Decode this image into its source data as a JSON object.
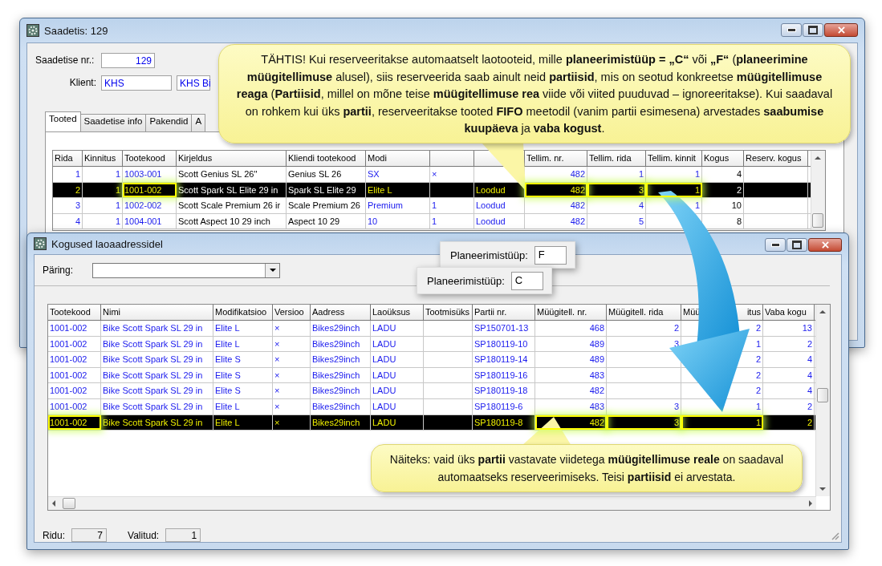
{
  "top_window": {
    "title": "Saadetis: 129",
    "shipment_number": {
      "label": "Saadetise nr.:",
      "value": "129"
    },
    "client": {
      "label": "Klient:",
      "code": "KHS",
      "name": "KHS Bi"
    },
    "tabs": [
      {
        "label": "Tooted",
        "selected": true
      },
      {
        "label": "Saadetise info",
        "selected": false
      },
      {
        "label": "Pakendid",
        "selected": false
      },
      {
        "label": "A",
        "selected": false
      }
    ],
    "table": {
      "columns": [
        {
          "label": "Rida",
          "highlight": false
        },
        {
          "label": "Kinnitus",
          "highlight": false
        },
        {
          "label": "Tootekood",
          "highlight": true
        },
        {
          "label": "Kirjeldus",
          "highlight": false
        },
        {
          "label": "Kliendi tootekood",
          "highlight": false
        },
        {
          "label": "Modi",
          "highlight": false
        },
        {
          "highlight": false
        },
        {
          "highlight": false
        },
        {
          "label": "Tellim. nr.",
          "highlight": true
        },
        {
          "label": "Tellim. rida",
          "highlight": true
        },
        {
          "label": "Tellim. kinnit",
          "highlight": true
        },
        {
          "label": "Kogus",
          "highlight": false
        },
        {
          "label": "Reserv. kogus",
          "highlight": false
        }
      ],
      "rows": [
        {
          "selected": false,
          "cells": [
            "1",
            "1",
            "1003-001",
            "Scott Genius SL 26''",
            "Genius SL 26",
            "SX",
            "×",
            null,
            "482",
            "1",
            "1",
            "4",
            null
          ]
        },
        {
          "selected": true,
          "cells": [
            "2",
            "1",
            "1001-002",
            "Scott Spark SL Elite 29 in",
            "Spark SL Elite 29",
            "Elite L",
            null,
            "Loodud",
            "482",
            "3",
            "1",
            "2",
            null
          ]
        },
        {
          "selected": false,
          "cells": [
            "3",
            "1",
            "1002-002",
            "Scott Scale Premium 26 ir",
            "Scale Premium 26",
            "Premium",
            "1",
            "Loodud",
            "482",
            "4",
            "1",
            "10",
            null
          ]
        },
        {
          "selected": false,
          "cells": [
            "4",
            "1",
            "1004-001",
            "Scott Aspect 10 29 inch",
            "Aspect 10 29",
            "10",
            "1",
            "Loodud",
            "482",
            "5",
            null,
            "8",
            null
          ]
        }
      ]
    }
  },
  "bottom_window": {
    "title": "Kogused laoaadressidel",
    "query": {
      "label": "Päring:"
    },
    "planning_popups": [
      {
        "label": "Planeerimistüüp:",
        "value": "F"
      },
      {
        "label": "Planeerimistüüp:",
        "value": "C"
      }
    ],
    "table": {
      "columns": [
        {
          "label": "Tootekood",
          "highlight": true
        },
        {
          "label": "Nimi",
          "highlight": false
        },
        {
          "label": "Modifikatsioo",
          "highlight": false
        },
        {
          "label": "Versioo",
          "highlight": false
        },
        {
          "label": "Aadress",
          "highlight": false
        },
        {
          "label": "Laoüksus",
          "highlight": false
        },
        {
          "label": "Tootmisüks",
          "highlight": false
        },
        {
          "label": "Partii nr.",
          "highlight": false
        },
        {
          "label": "Müügitell. nr.",
          "highlight": true
        },
        {
          "label": "Müügitell. rida",
          "highlight": true
        },
        {
          "label": "Müü",
          "label_end": "itus",
          "highlight": true
        },
        {
          "label": "Vaba kogu",
          "highlight": false
        }
      ],
      "rows": [
        {
          "selected": false,
          "cells": [
            "1001-002",
            "Bike Scott Spark SL 29 in",
            "Elite L",
            "×",
            "Bikes29inch",
            "LADU",
            null,
            "SP150701-13",
            "468",
            "2",
            "2",
            "13"
          ]
        },
        {
          "selected": false,
          "cells": [
            "1001-002",
            "Bike Scott Spark SL 29 in",
            "Elite L",
            "×",
            "Bikes29inch",
            "LADU",
            null,
            "SP180119-10",
            "489",
            "3",
            "1",
            "2"
          ]
        },
        {
          "selected": false,
          "cells": [
            "1001-002",
            "Bike Scott Spark SL 29 in",
            "Elite S",
            "×",
            "Bikes29inch",
            "LADU",
            null,
            "SP180119-14",
            "489",
            null,
            "2",
            "4"
          ]
        },
        {
          "selected": false,
          "cells": [
            "1001-002",
            "Bike Scott Spark SL 29 in",
            "Elite S",
            "×",
            "Bikes29inch",
            "LADU",
            null,
            "SP180119-16",
            "483",
            null,
            "2",
            "4"
          ]
        },
        {
          "selected": false,
          "cells": [
            "1001-002",
            "Bike Scott Spark SL 29 in",
            "Elite S",
            "×",
            "Bikes29inch",
            "LADU",
            null,
            "SP180119-18",
            "482",
            null,
            "2",
            "4"
          ]
        },
        {
          "selected": false,
          "cells": [
            "1001-002",
            "Bike Scott Spark SL 29 in",
            "Elite L",
            "×",
            "Bikes29inch",
            "LADU",
            null,
            "SP180119-6",
            "483",
            "3",
            "1",
            "2"
          ]
        },
        {
          "selected": true,
          "cells": [
            "1001-002",
            "Bike Scott Spark SL 29 in",
            "Elite L",
            "×",
            "Bikes29inch",
            "LADU",
            null,
            "SP180119-8",
            "482",
            "3",
            "1",
            "2"
          ]
        }
      ]
    },
    "status": [
      {
        "label": "Ridu:",
        "value": "7"
      },
      {
        "label": "Valitud:",
        "value": "1"
      }
    ]
  },
  "callouts": [
    {
      "text": "TÄHTIS! Kui reserveeritakse automaatselt laotooteid, mille **planeerimistüüp = „C“** või **„F“** (**planeerimine müügitellimuse** alusel), siis reserveerida saab ainult neid **partiisid**, mis on seotud konkreetse **müügitellimuse reaga** (**Partiisid**, millel on mõne teise **müügitellimuse rea** viide või viited puuduvad – ignoreeritakse). Kui saadaval on rohkem kui üks **partii**, reserveeritakse tooted **FIFO** meetodil (vanim partii esimesena) arvestades **saabumise kuupäeva** ja **vaba kogust**."
    },
    {
      "text": "Näiteks: vaid üks **partii** vastavate viidetega **müügitellimuse reale** on saadaval automaatseks reserveerimiseks. Teisi **partiisid** ei arvestata."
    }
  ]
}
